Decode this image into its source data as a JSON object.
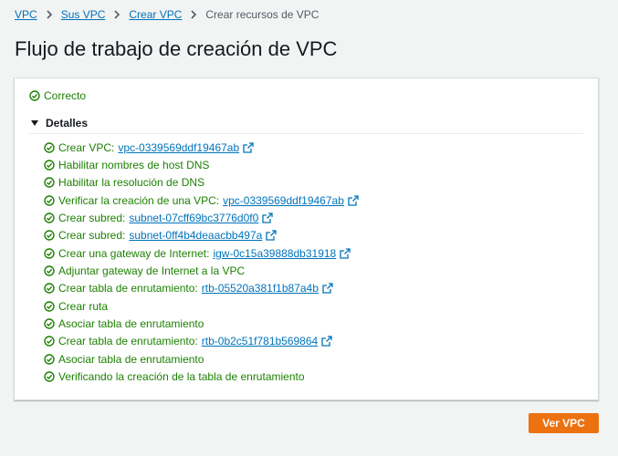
{
  "breadcrumb": {
    "items": [
      {
        "label": "VPC"
      },
      {
        "label": "Sus VPC"
      },
      {
        "label": "Crear VPC"
      }
    ],
    "current": "Crear recursos de VPC"
  },
  "page_title": "Flujo de trabajo de creación de VPC",
  "status": {
    "label": "Correcto",
    "color": "#1d8102"
  },
  "details": {
    "toggle_label": "Detalles",
    "steps": [
      {
        "label": "Crear VPC:",
        "link": "vpc-0339569ddf19467ab"
      },
      {
        "label": "Habilitar nombres de host DNS"
      },
      {
        "label": "Habilitar la resolución de DNS"
      },
      {
        "label": "Verificar la creación de una VPC:",
        "link": "vpc-0339569ddf19467ab"
      },
      {
        "label": "Crear subred:",
        "link": "subnet-07cff69bc3776d0f0"
      },
      {
        "label": "Crear subred:",
        "link": "subnet-0ff4b4deaacbb497a"
      },
      {
        "label": "Crear una gateway de Internet:",
        "link": "igw-0c15a39888db31918"
      },
      {
        "label": "Adjuntar gateway de Internet a la VPC"
      },
      {
        "label": "Crear tabla de enrutamiento:",
        "link": "rtb-05520a381f1b87a4b"
      },
      {
        "label": "Crear ruta"
      },
      {
        "label": "Asociar tabla de enrutamiento"
      },
      {
        "label": "Crear tabla de enrutamiento:",
        "link": "rtb-0b2c51f781b569864"
      },
      {
        "label": "Asociar tabla de enrutamiento"
      },
      {
        "label": "Verificando la creación de la tabla de enrutamiento"
      }
    ]
  },
  "actions": {
    "view_vpc": "Ver VPC"
  },
  "colors": {
    "link": "#0073bb",
    "success": "#1d8102",
    "primary": "#ec7211"
  }
}
